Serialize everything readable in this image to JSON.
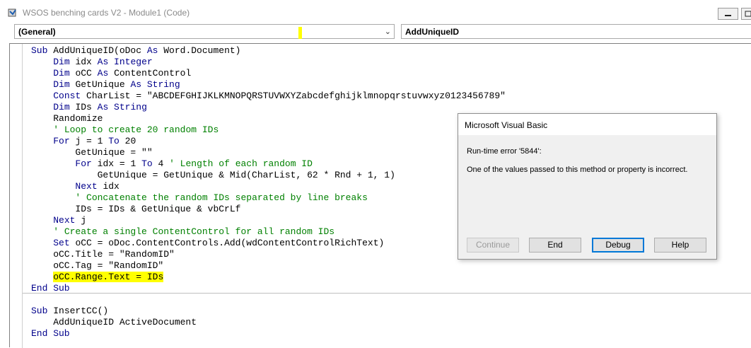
{
  "window": {
    "title": "WSOS benching cards V2 - Module1 (Code)",
    "minimize_icon": "minimize-icon",
    "restore_icon": "restore-icon"
  },
  "object_combo": {
    "value": "(General)"
  },
  "procedure_combo": {
    "value": "AddUniqueID"
  },
  "code_lines": [
    [
      {
        "t": "Sub ",
        "c": "kw"
      },
      {
        "t": "AddUniqueID(oDoc "
      },
      {
        "t": "As ",
        "c": "kw"
      },
      {
        "t": "Word.Document)"
      }
    ],
    [
      {
        "t": "    "
      },
      {
        "t": "Dim ",
        "c": "kw"
      },
      {
        "t": "idx "
      },
      {
        "t": "As Integer",
        "c": "kw"
      }
    ],
    [
      {
        "t": "    "
      },
      {
        "t": "Dim ",
        "c": "kw"
      },
      {
        "t": "oCC "
      },
      {
        "t": "As ",
        "c": "kw"
      },
      {
        "t": "ContentControl"
      }
    ],
    [
      {
        "t": "    "
      },
      {
        "t": "Dim ",
        "c": "kw"
      },
      {
        "t": "GetUnique "
      },
      {
        "t": "As String",
        "c": "kw"
      }
    ],
    [
      {
        "t": "    "
      },
      {
        "t": "Const ",
        "c": "kw"
      },
      {
        "t": "CharList = \"ABCDEFGHIJKLKMNOPQRSTUVWXYZabcdefghijklmnopqrstuvwxyz0123456789\""
      }
    ],
    [
      {
        "t": "    "
      },
      {
        "t": "Dim ",
        "c": "kw"
      },
      {
        "t": "IDs "
      },
      {
        "t": "As String",
        "c": "kw"
      }
    ],
    [
      {
        "t": "    Randomize"
      }
    ],
    [
      {
        "t": "    "
      },
      {
        "t": "' Loop to create 20 random IDs",
        "c": "cm"
      }
    ],
    [
      {
        "t": "    "
      },
      {
        "t": "For ",
        "c": "kw"
      },
      {
        "t": "j = 1 "
      },
      {
        "t": "To ",
        "c": "kw"
      },
      {
        "t": "20"
      }
    ],
    [
      {
        "t": "        GetUnique = \"\""
      }
    ],
    [
      {
        "t": "        "
      },
      {
        "t": "For ",
        "c": "kw"
      },
      {
        "t": "idx = 1 "
      },
      {
        "t": "To ",
        "c": "kw"
      },
      {
        "t": "4 "
      },
      {
        "t": "' Length of each random ID",
        "c": "cm"
      }
    ],
    [
      {
        "t": "            GetUnique = GetUnique & Mid(CharList, 62 * Rnd + 1, 1)"
      }
    ],
    [
      {
        "t": "        "
      },
      {
        "t": "Next ",
        "c": "kw"
      },
      {
        "t": "idx"
      }
    ],
    [
      {
        "t": "        "
      },
      {
        "t": "' Concatenate the random IDs separated by line breaks",
        "c": "cm"
      }
    ],
    [
      {
        "t": "        IDs = IDs & GetUnique & vbCrLf"
      }
    ],
    [
      {
        "t": "    "
      },
      {
        "t": "Next ",
        "c": "kw"
      },
      {
        "t": "j"
      }
    ],
    [
      {
        "t": "    "
      },
      {
        "t": "' Create a single ContentControl for all random IDs",
        "c": "cm"
      }
    ],
    [
      {
        "t": "    "
      },
      {
        "t": "Set ",
        "c": "kw"
      },
      {
        "t": "oCC = oDoc.ContentControls.Add(wdContentControlRichText)"
      }
    ],
    [
      {
        "t": "    oCC.Title = \"RandomID\""
      }
    ],
    [
      {
        "t": "    oCC.Tag = \"RandomID\""
      }
    ],
    [
      {
        "t": "    "
      },
      {
        "t": "oCC.Range.Text = IDs",
        "c": "hl"
      }
    ],
    [
      {
        "t": "End Sub",
        "c": "kw"
      }
    ],
    [
      {
        "t": ""
      }
    ],
    [
      {
        "t": "Sub ",
        "c": "kw"
      },
      {
        "t": "InsertCC()"
      }
    ],
    [
      {
        "t": "    AddUniqueID ActiveDocument"
      }
    ],
    [
      {
        "t": "End Sub",
        "c": "kw"
      }
    ]
  ],
  "dialog": {
    "title": "Microsoft Visual Basic",
    "error_title": "Run-time error '5844':",
    "error_message": "One of the values passed to this method or property is incorrect.",
    "buttons": {
      "continue_label": "Continue",
      "end_label": "End",
      "debug_label": "Debug",
      "help_label": "Help"
    }
  },
  "colors": {
    "keyword": "#00008b",
    "comment": "#008000",
    "highlight": "#ffff00",
    "default_button_border": "#0078d7"
  }
}
